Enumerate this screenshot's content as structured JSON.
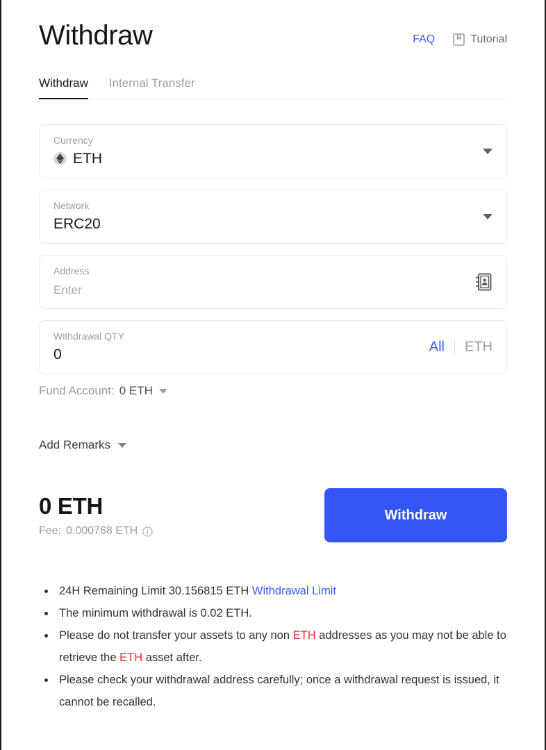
{
  "header": {
    "title": "Withdraw",
    "faq_label": "FAQ",
    "tutorial_label": "Tutorial"
  },
  "tabs": [
    {
      "label": "Withdraw",
      "active": true
    },
    {
      "label": "Internal Transfer",
      "active": false
    }
  ],
  "form": {
    "currency": {
      "label": "Currency",
      "value": "ETH"
    },
    "network": {
      "label": "Network",
      "value": "ERC20"
    },
    "address": {
      "label": "Address",
      "placeholder": "Enter",
      "value": ""
    },
    "quantity": {
      "label": "Withdrawal QTY",
      "value": "0",
      "all_label": "All",
      "unit_label": "ETH"
    },
    "fund_account": {
      "label": "Fund Account:",
      "amount": "0 ETH"
    },
    "remarks": {
      "label": "Add Remarks"
    }
  },
  "summary": {
    "total": "0 ETH",
    "fee_label": "Fee:",
    "fee_value": "0.000768 ETH",
    "submit_label": "Withdraw"
  },
  "notes": {
    "limit_prefix": "24H Remaining Limit 30.156815 ETH ",
    "limit_link": "Withdrawal Limit",
    "minimum": "The minimum withdrawal is 0.02 ETH.",
    "transfer_part1": "Please do not transfer your assets to any non ",
    "transfer_token1": "ETH",
    "transfer_part2": " addresses as you may not be able to retrieve the ",
    "transfer_token2": "ETH",
    "transfer_part3": " asset after.",
    "check_address": "Please check your withdrawal address carefully; once a withdrawal request is issued, it cannot be recalled."
  },
  "colors": {
    "accent": "#3355f5",
    "link": "#3c5bf5",
    "warning": "#f5222d",
    "text": "#15161a",
    "muted": "#9a9da5"
  }
}
